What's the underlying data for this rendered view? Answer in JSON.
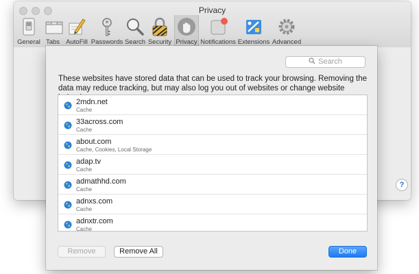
{
  "window": {
    "title": "Privacy"
  },
  "toolbar": {
    "items": [
      {
        "label": "General",
        "icon": "general-switch-icon"
      },
      {
        "label": "Tabs",
        "icon": "tabs-icon"
      },
      {
        "label": "AutoFill",
        "icon": "autofill-pencil-icon"
      },
      {
        "label": "Passwords",
        "icon": "key-icon"
      },
      {
        "label": "Search",
        "icon": "magnifier-icon"
      },
      {
        "label": "Security",
        "icon": "padlock-icon"
      },
      {
        "label": "Privacy",
        "icon": "hand-icon",
        "selected": true
      },
      {
        "label": "Notifications",
        "icon": "notifications-icon"
      },
      {
        "label": "Extensions",
        "icon": "extensions-icon"
      },
      {
        "label": "Advanced",
        "icon": "gear-icon"
      }
    ]
  },
  "sheet": {
    "search_placeholder": "Search",
    "description": "These websites have stored data that can be used to track your browsing. Removing the data may reduce tracking, but may also log you out of websites or change website behavior.",
    "sites": [
      {
        "name": "2mdn.net",
        "data": "Cache"
      },
      {
        "name": "33across.com",
        "data": "Cache"
      },
      {
        "name": "about.com",
        "data": "Cache, Cookies, Local Storage"
      },
      {
        "name": "adap.tv",
        "data": "Cache"
      },
      {
        "name": "admathhd.com",
        "data": "Cache"
      },
      {
        "name": "adnxs.com",
        "data": "Cache"
      },
      {
        "name": "adnxtr.com",
        "data": "Cache"
      }
    ],
    "buttons": {
      "remove": "Remove",
      "remove_all": "Remove All",
      "done": "Done"
    }
  },
  "colors": {
    "accent": "#1e79f0",
    "globe": "#2f7fd8",
    "notification_badge": "#f45a52"
  }
}
